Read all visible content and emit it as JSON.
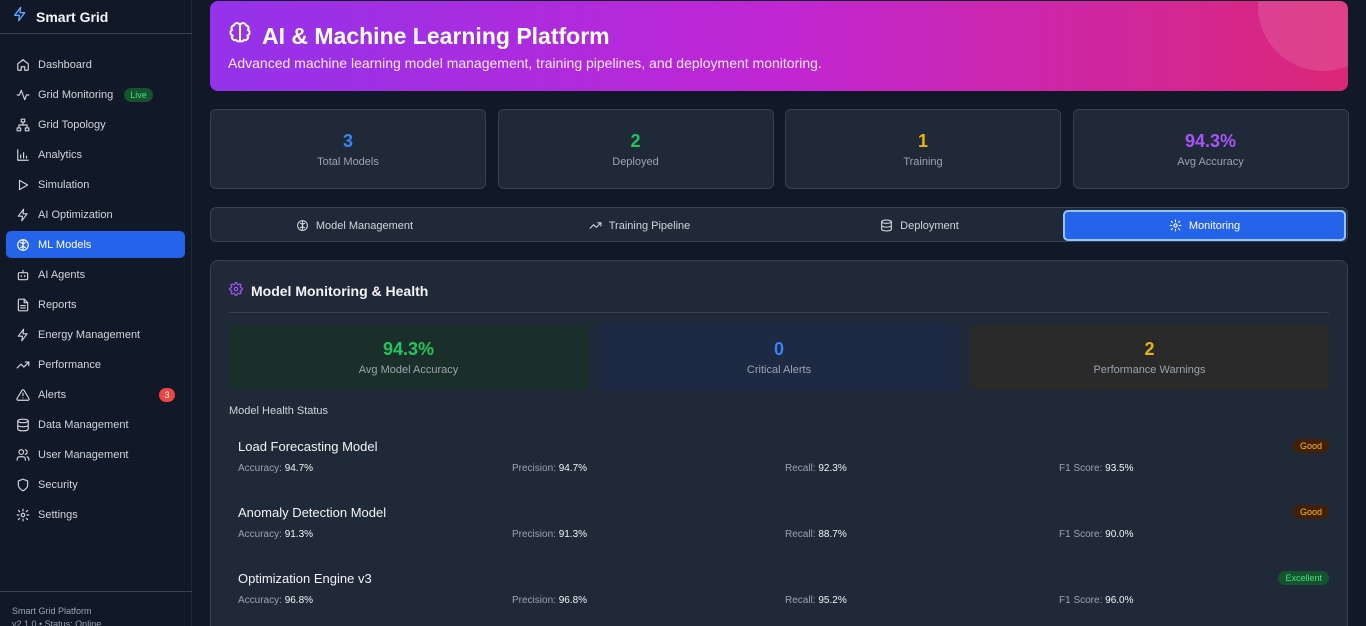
{
  "sidebar": {
    "brand": "Smart Grid",
    "items": [
      {
        "label": "Dashboard",
        "icon": "home-icon"
      },
      {
        "label": "Grid Monitoring",
        "icon": "activity-icon",
        "badge": "Live"
      },
      {
        "label": "Grid Topology",
        "icon": "network-icon"
      },
      {
        "label": "Analytics",
        "icon": "bar-chart-icon"
      },
      {
        "label": "Simulation",
        "icon": "play-icon"
      },
      {
        "label": "AI Optimization",
        "icon": "bolt-icon"
      },
      {
        "label": "ML Models",
        "icon": "brain-icon",
        "active": true
      },
      {
        "label": "AI Agents",
        "icon": "bot-icon"
      },
      {
        "label": "Reports",
        "icon": "file-icon"
      },
      {
        "label": "Energy Management",
        "icon": "bolt-icon"
      },
      {
        "label": "Performance",
        "icon": "trending-up-icon"
      },
      {
        "label": "Alerts",
        "icon": "alert-triangle-icon",
        "badge": "3"
      },
      {
        "label": "Data Management",
        "icon": "database-icon"
      },
      {
        "label": "User Management",
        "icon": "users-icon"
      },
      {
        "label": "Security",
        "icon": "shield-icon"
      },
      {
        "label": "Settings",
        "icon": "gear-icon"
      }
    ],
    "footer_line1": "Smart Grid Platform",
    "footer_line2": "v2.1.0 • Status: Online"
  },
  "hero": {
    "title": "AI & Machine Learning Platform",
    "subtitle": "Advanced machine learning model management, training pipelines, and deployment monitoring."
  },
  "stats": [
    {
      "value": "3",
      "label": "Total Models",
      "color": "#3b82f6"
    },
    {
      "value": "2",
      "label": "Deployed",
      "color": "#22c55e"
    },
    {
      "value": "1",
      "label": "Training",
      "color": "#eab308"
    },
    {
      "value": "94.3%",
      "label": "Avg Accuracy",
      "color": "#a855f7"
    }
  ],
  "tabs": [
    {
      "label": "Model Management",
      "icon": "brain-icon"
    },
    {
      "label": "Training Pipeline",
      "icon": "trending-up-icon"
    },
    {
      "label": "Deployment",
      "icon": "database-icon"
    },
    {
      "label": "Monitoring",
      "icon": "gear-icon",
      "active": true
    }
  ],
  "monitoring": {
    "title": "Model Monitoring & Health",
    "boxes": [
      {
        "value": "94.3%",
        "label": "Avg Model Accuracy",
        "color": "#22c55e",
        "bg": "#1a2e2a"
      },
      {
        "value": "0",
        "label": "Critical Alerts",
        "color": "#3b82f6",
        "bg": "#1e2a44"
      },
      {
        "value": "2",
        "label": "Performance Warnings",
        "color": "#eab308",
        "bg": "#2a2a2b"
      }
    ],
    "health_label": "Model Health Status",
    "metric_labels": {
      "accuracy": "Accuracy:",
      "precision": "Precision:",
      "recall": "Recall:",
      "f1": "F1 Score:"
    },
    "models": [
      {
        "name": "Load Forecasting Model",
        "status": "Good",
        "status_kind": "good",
        "accuracy": "94.7%",
        "precision": "94.7%",
        "recall": "92.3%",
        "f1": "93.5%"
      },
      {
        "name": "Anomaly Detection Model",
        "status": "Good",
        "status_kind": "good",
        "accuracy": "91.3%",
        "precision": "91.3%",
        "recall": "88.7%",
        "f1": "90.0%"
      },
      {
        "name": "Optimization Engine v3",
        "status": "Excellent",
        "status_kind": "excellent",
        "accuracy": "96.8%",
        "precision": "96.8%",
        "recall": "95.2%",
        "f1": "96.0%"
      }
    ]
  }
}
